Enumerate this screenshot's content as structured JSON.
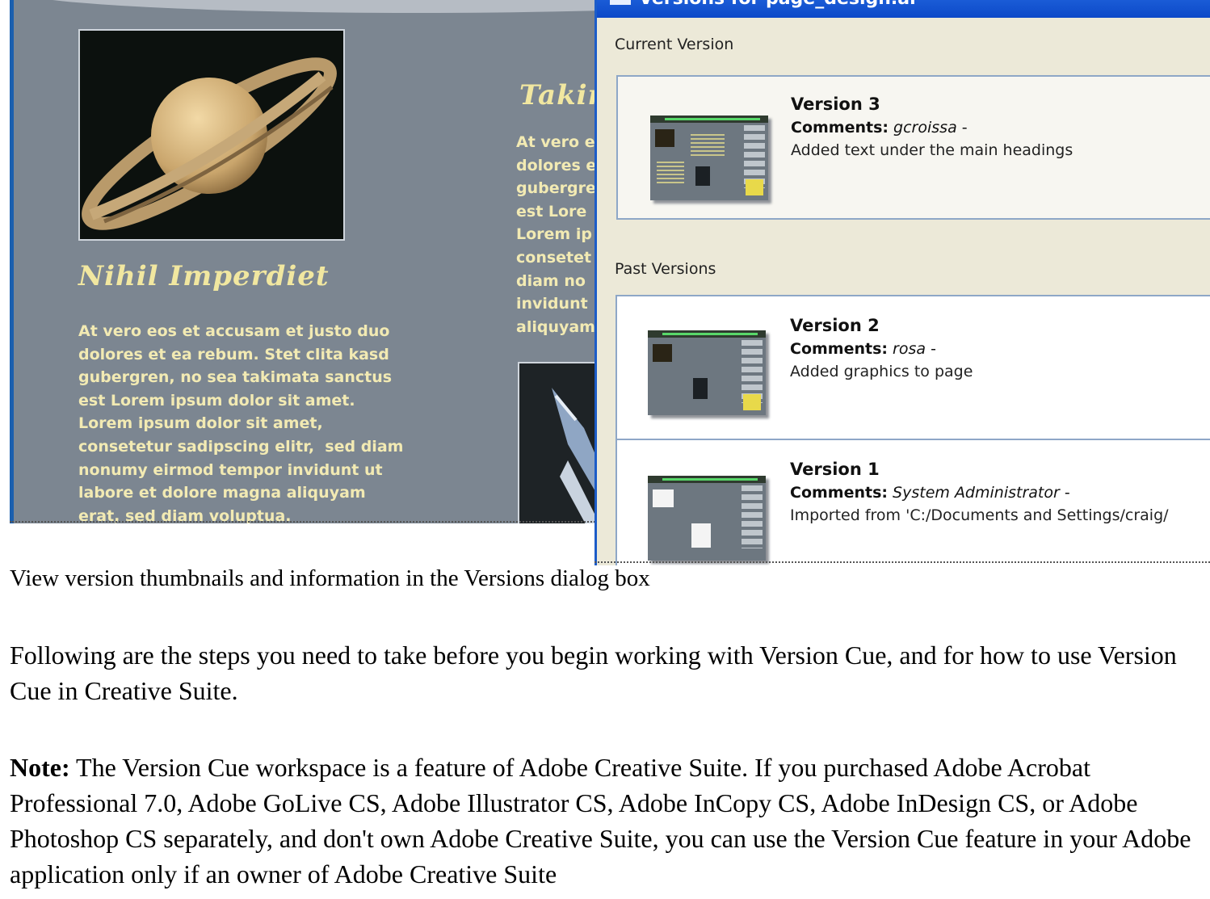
{
  "background_page": {
    "heading_left": "Nihil Imperdiet",
    "heading_right": "Takin",
    "body_left_lines": [
      "At vero eos et accusam et justo duo",
      "dolores et ea rebum. Stet clita kasd",
      "gubergren, no sea takimata sanctus",
      "est Lorem ipsum dolor sit amet.",
      "Lorem ipsum dolor sit amet,",
      "consetetur sadipscing elitr,  sed diam",
      "nonumy eirmod tempor invidunt ut",
      "labore et dolore magna aliquyam",
      "erat, sed diam voluptua."
    ],
    "body_right_lines": [
      "At vero e",
      "dolores e",
      "gubergre",
      "est Lore",
      "Lorem ip",
      "consetet",
      "diam no",
      "invidunt",
      "aliquyam"
    ]
  },
  "dialog": {
    "title": "Versions for page_design.ai",
    "current_label": "Current Version",
    "past_label": "Past Versions",
    "comments_label": "Comments:",
    "current": {
      "title": "Version 3",
      "author": "gcroissa",
      "description": "Added text under the main headings"
    },
    "past": [
      {
        "title": "Version 2",
        "author": "rosa",
        "description": "Added graphics to page"
      },
      {
        "title": "Version 1",
        "author": "System Administrator",
        "description": "Imported from 'C:/Documents and Settings/craig/"
      }
    ]
  },
  "document": {
    "caption": "View version thumbnails and information in the Versions dialog box",
    "paragraph1": "Following are the steps you need to take before you begin working with Version Cue, and for how to use Version Cue in Creative Suite.",
    "note_label": "Note:",
    "note_text": " The Version Cue workspace is a feature of Adobe Creative Suite. If you purchased Adobe Acrobat Professional 7.0, Adobe GoLive CS, Adobe Illustrator CS, Adobe InCopy CS, Adobe InDesign CS, or Adobe Photoshop CS separately, and don't own Adobe Creative Suite, you can use the Version Cue feature in your Adobe application only if an owner of Adobe Creative Suite"
  }
}
